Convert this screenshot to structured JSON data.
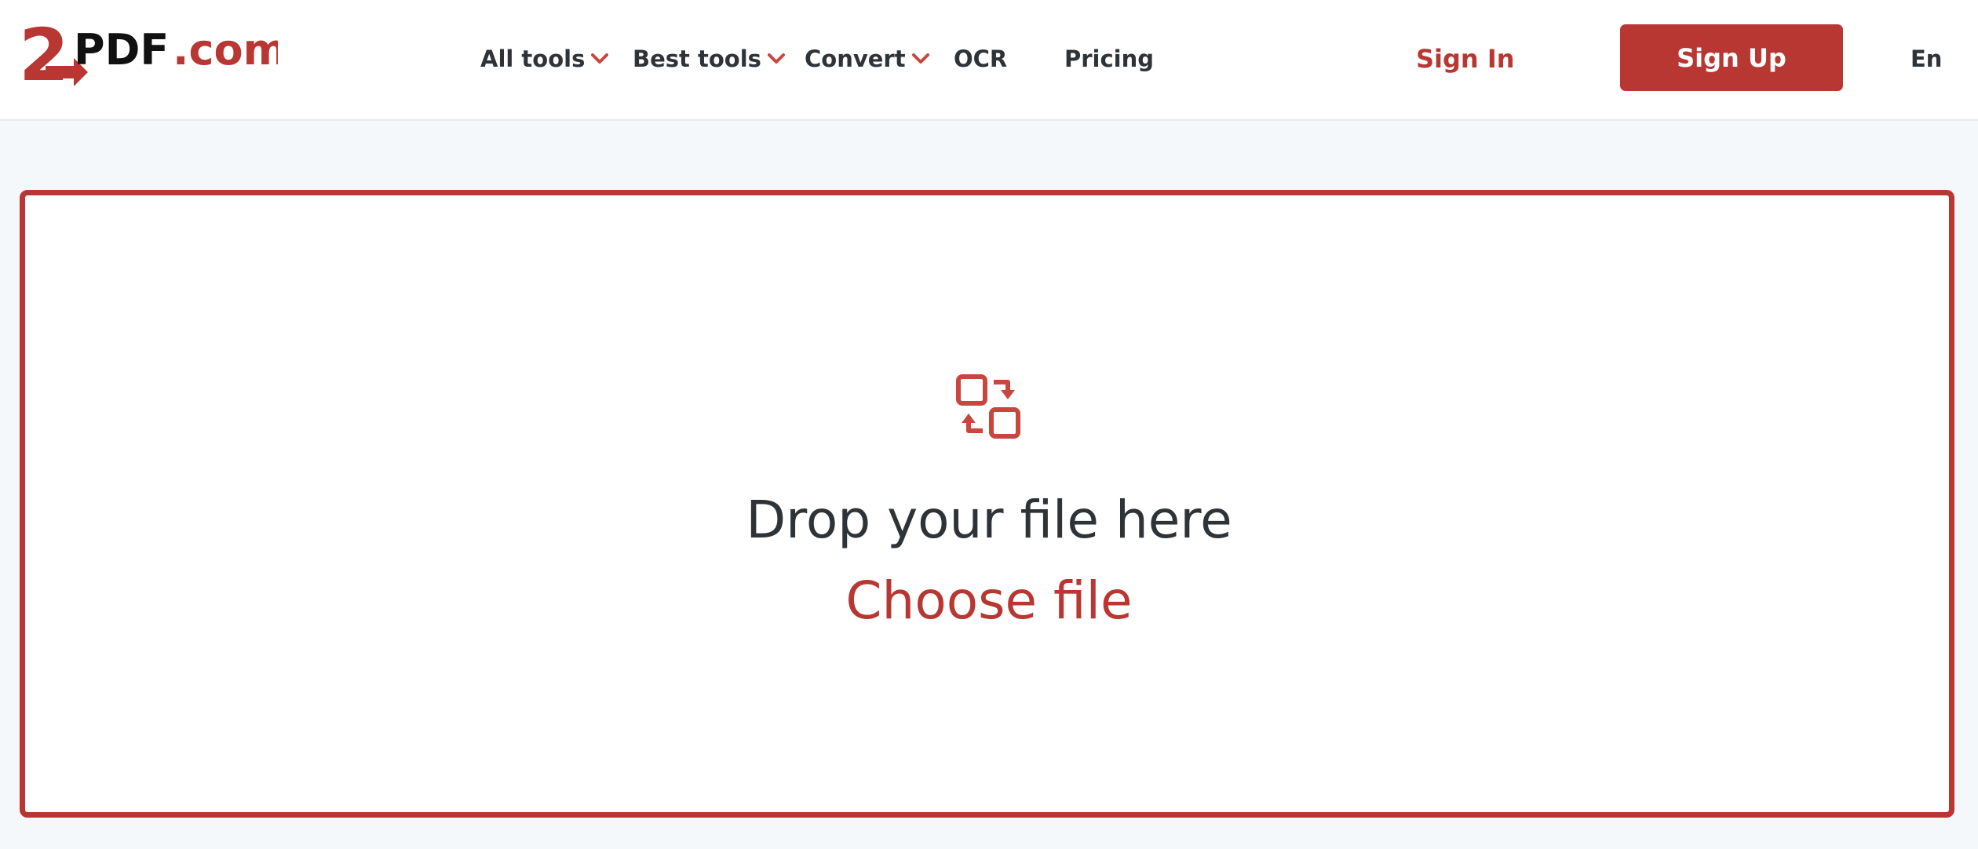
{
  "brand": {
    "logo_number": "2",
    "logo_text": "PDF",
    "logo_suffix": ".com",
    "accent_color": "#b83733"
  },
  "nav": {
    "all_tools": "All tools",
    "best_tools": "Best tools",
    "convert": "Convert",
    "ocr": "OCR",
    "pricing": "Pricing"
  },
  "auth": {
    "sign_in": "Sign In",
    "sign_up": "Sign Up"
  },
  "language": "En",
  "upload": {
    "icon": "convert-arrows-icon",
    "drop_text": "Drop your file here",
    "choose_file": "Choose file"
  }
}
